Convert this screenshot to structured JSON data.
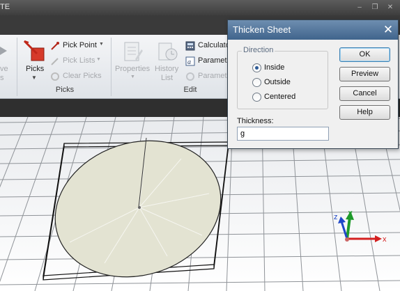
{
  "window": {
    "title_fragment": "TE",
    "minimize": "–",
    "restore": "❐",
    "close": "✕"
  },
  "ribbon": {
    "groups": [
      {
        "label": "Picks",
        "big_button": {
          "label": "Picks",
          "icon": "picks-icon"
        },
        "items": [
          {
            "label": "Pick Point",
            "icon": "pick-point-icon",
            "enabled": true
          },
          {
            "label": "Pick Lists",
            "icon": "pick-lists-icon",
            "enabled": false
          },
          {
            "label": "Clear Picks",
            "icon": "clear-picks-icon",
            "enabled": false
          }
        ]
      },
      {
        "label": "Edit",
        "big_buttons": [
          {
            "label": "Properties",
            "icon": "properties-icon",
            "enabled": false
          },
          {
            "label_line1": "History",
            "label_line2": "List",
            "icon": "history-list-icon",
            "enabled": false
          }
        ],
        "items": [
          {
            "label": "Calculato",
            "icon": "calculator-icon",
            "enabled": true
          },
          {
            "label": "Paramet",
            "icon": "parameter-icon",
            "enabled": true
          },
          {
            "label": "Paramet",
            "icon": "parameter-refresh-icon",
            "enabled": false
          }
        ]
      }
    ],
    "left_clipped": {
      "line1": "ve",
      "line2": "s"
    }
  },
  "dialog": {
    "title": "Thicken Sheet",
    "direction": {
      "legend": "Direction",
      "options": [
        "Inside",
        "Outside",
        "Centered"
      ],
      "selected": "Inside"
    },
    "thickness": {
      "label": "Thickness:",
      "value": "g"
    },
    "buttons": {
      "ok": "OK",
      "preview": "Preview",
      "cancel": "Cancel",
      "help": "Help"
    }
  },
  "viewport": {
    "axes": {
      "x": "x",
      "y": "y",
      "z": "z"
    },
    "colors": {
      "x_axis": "#d42020",
      "y_axis": "#1e9a2a",
      "z_axis": "#1f47c8",
      "disk": "#e3e3d2"
    }
  }
}
